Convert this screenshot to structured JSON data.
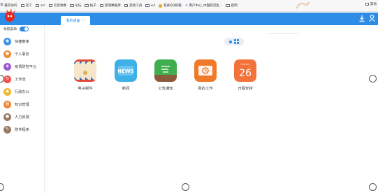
{
  "browser": {
    "bookmarks": [
      {
        "label": "最常访问",
        "icon": "gear-icon"
      },
      {
        "label": "社工",
        "icon": "folder-icon"
      },
      {
        "label": "src",
        "icon": "folder-icon"
      },
      {
        "label": "信息收集",
        "icon": "folder-icon"
      },
      {
        "label": "论坛",
        "icon": "folder-icon"
      },
      {
        "label": "帖子",
        "icon": "folder-icon"
      },
      {
        "label": "漏洞数据库",
        "icon": "folder-icon"
      },
      {
        "label": "其他工具",
        "icon": "folder-icon"
      },
      {
        "label": "vul",
        "icon": "folder-icon"
      },
      {
        "label": "登录QQ邮箱",
        "icon": "qq-icon"
      },
      {
        "label": "用户中心_中国研究生...",
        "icon": "star-icon"
      },
      {
        "label": "启明",
        "icon": "folder-icon"
      }
    ],
    "right_bookmark": "其他"
  },
  "header": {
    "tab_label": "我的桌面",
    "tab_close": "×",
    "download_icon": "download-icon",
    "user_icon": "user-icon",
    "accent": "#2d8ce6"
  },
  "sidebar": {
    "toggle_label": "导航菜单",
    "items": [
      {
        "label": "快捷菜单",
        "color": "#3d93e6",
        "icon": "compass-icon"
      },
      {
        "label": "个人事务",
        "color": "#f08c3a",
        "icon": "person-icon"
      },
      {
        "label": "疫情防控平台",
        "color": "#9b59d0",
        "icon": "shield-icon"
      },
      {
        "label": "工作流",
        "color": "#ef5350",
        "icon": "flow-icon"
      },
      {
        "label": "行政办公",
        "color": "#f2b632",
        "icon": "office-icon"
      },
      {
        "label": "知识管理",
        "color": "#f0822e",
        "icon": "book-icon"
      },
      {
        "label": "人力资源",
        "color": "#9b7b63",
        "icon": "people-icon"
      },
      {
        "label": "附件程序",
        "color": "#9b7b63",
        "icon": "attachment-icon"
      }
    ]
  },
  "apps": [
    {
      "label": "电子邮件",
      "icon": "mail-icon"
    },
    {
      "label": "新闻",
      "icon": "news-icon",
      "icon_text": "NEWS"
    },
    {
      "label": "公告通知",
      "icon": "notice-icon"
    },
    {
      "label": "我的工作",
      "icon": "work-icon"
    },
    {
      "label": "日程安排",
      "icon": "calendar-icon",
      "icon_text": "26",
      "icon_small": "Sunday"
    }
  ]
}
